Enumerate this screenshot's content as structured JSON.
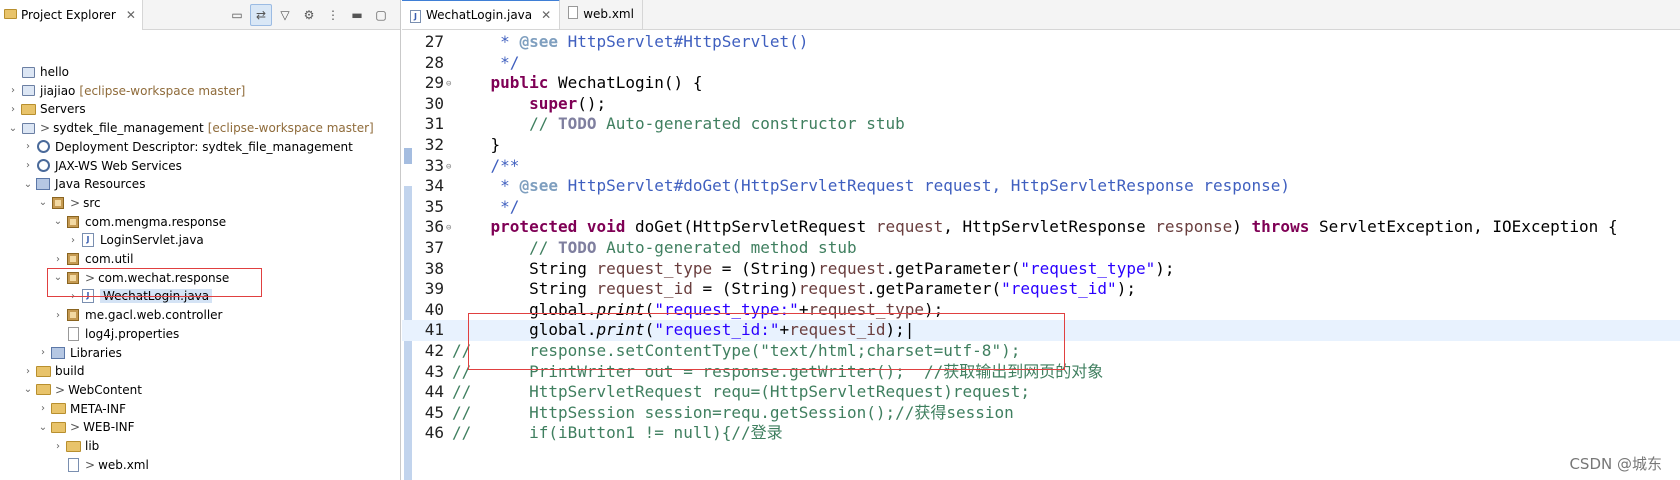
{
  "explorer": {
    "title": "Project Explorer",
    "close_glyph": "✕",
    "tools": [
      "collapse-all-icon",
      "link-editor-icon",
      "filter-icon",
      "view-options-icon",
      "view-menu-icon",
      "minimize-icon",
      "maximize-icon"
    ],
    "tree": [
      {
        "label": "hello",
        "arrow": "",
        "icon": "project",
        "indent": 0,
        "dim": ""
      },
      {
        "label": "jiajiao",
        "arrow": ">",
        "icon": "project",
        "indent": 0,
        "dim": "[eclipse-workspace master]"
      },
      {
        "label": "Servers",
        "arrow": ">",
        "icon": "folder",
        "indent": 0,
        "dim": ""
      },
      {
        "label": "sydtek_file_management",
        "arrow": "v",
        "icon": "project",
        "indent": 0,
        "dim": "[eclipse-workspace master]",
        "pre": ">"
      },
      {
        "label": "Deployment Descriptor: sydtek_file_management",
        "arrow": ">",
        "icon": "gear",
        "indent": 1,
        "dim": ""
      },
      {
        "label": "JAX-WS Web Services",
        "arrow": ">",
        "icon": "gear",
        "indent": 1,
        "dim": ""
      },
      {
        "label": "Java Resources",
        "arrow": "v",
        "icon": "lib",
        "indent": 1,
        "dim": ""
      },
      {
        "label": "src",
        "arrow": "v",
        "icon": "pkg",
        "indent": 2,
        "dim": "",
        "pre": ">"
      },
      {
        "label": "com.mengma.response",
        "arrow": "v",
        "icon": "pkg",
        "indent": 3,
        "dim": ""
      },
      {
        "label": "LoginServlet.java",
        "arrow": ">",
        "icon": "java",
        "indent": 4,
        "dim": ""
      },
      {
        "label": "com.util",
        "arrow": ">",
        "icon": "pkg",
        "indent": 3,
        "dim": ""
      },
      {
        "label": "com.wechat.response",
        "arrow": "v",
        "icon": "pkg",
        "indent": 3,
        "dim": "",
        "pre": ">"
      },
      {
        "label": "WechatLogin.java",
        "arrow": ">",
        "icon": "java",
        "indent": 4,
        "dim": "",
        "selected": true
      },
      {
        "label": "me.gacl.web.controller",
        "arrow": ">",
        "icon": "pkg",
        "indent": 3,
        "dim": ""
      },
      {
        "label": "log4j.properties",
        "arrow": "",
        "icon": "file",
        "indent": 3,
        "dim": ""
      },
      {
        "label": "Libraries",
        "arrow": ">",
        "icon": "lib",
        "indent": 2,
        "dim": ""
      },
      {
        "label": "build",
        "arrow": ">",
        "icon": "folder",
        "indent": 1,
        "dim": ""
      },
      {
        "label": "WebContent",
        "arrow": "v",
        "icon": "folder",
        "indent": 1,
        "dim": "",
        "pre": ">"
      },
      {
        "label": "META-INF",
        "arrow": ">",
        "icon": "folder",
        "indent": 2,
        "dim": ""
      },
      {
        "label": "WEB-INF",
        "arrow": "v",
        "icon": "folder",
        "indent": 2,
        "dim": "",
        "pre": ">"
      },
      {
        "label": "lib",
        "arrow": ">",
        "icon": "folder",
        "indent": 3,
        "dim": ""
      },
      {
        "label": "web.xml",
        "arrow": "",
        "icon": "xml",
        "indent": 3,
        "dim": "",
        "pre": ">"
      }
    ]
  },
  "editor": {
    "tabs": [
      {
        "label": "WechatLogin.java",
        "active": true,
        "close": "✕"
      },
      {
        "label": "web.xml",
        "active": false,
        "close": ""
      }
    ],
    "lines": [
      {
        "n": "27",
        "fold": "",
        "html": "     <span class=\"jd\">* <span class=\"tag\">@see</span> HttpServlet#HttpServlet()</span>"
      },
      {
        "n": "28",
        "fold": "",
        "html": "     <span class=\"jd\">*/</span>"
      },
      {
        "n": "29",
        "fold": "⊖",
        "html": "    <span class=\"kw\">public</span> WechatLogin() {"
      },
      {
        "n": "30",
        "fold": "",
        "html": "        <span class=\"kw\">super</span>();"
      },
      {
        "n": "31",
        "fold": "",
        "html": "        <span class=\"cm\">// <span class=\"ann\">TODO</span> Auto-generated constructor stub</span>"
      },
      {
        "n": "32",
        "fold": "",
        "html": "    }"
      },
      {
        "n": "33",
        "fold": "⊖",
        "html": "    <span class=\"jd\">/**</span>"
      },
      {
        "n": "34",
        "fold": "",
        "html": "     <span class=\"jd\">* <span class=\"tag\">@see</span> HttpServlet#doGet(HttpServletRequest request, HttpServletResponse response)</span>"
      },
      {
        "n": "35",
        "fold": "",
        "html": "     <span class=\"jd\">*/</span>"
      },
      {
        "n": "36",
        "fold": "⊖",
        "html": "    <span class=\"kw\">protected void</span> doGet(HttpServletRequest <span class=\"var\">request</span>, HttpServletResponse <span class=\"var\">response</span>) <span class=\"kw\">throws</span> ServletException, IOException {"
      },
      {
        "n": "37",
        "fold": "",
        "html": "        <span class=\"cm\">// <span class=\"ann\">TODO</span> Auto-generated method stub</span>"
      },
      {
        "n": "38",
        "fold": "",
        "html": "        String <span class=\"var\">request_type</span> = (String)<span class=\"var\">request</span>.getParameter(<span class=\"str\">\"request_type\"</span>);"
      },
      {
        "n": "39",
        "fold": "",
        "html": "        String <span class=\"var\">request_id</span> = (String)<span class=\"var\">request</span>.getParameter(<span class=\"str\">\"request_id\"</span>);"
      },
      {
        "n": "40",
        "fold": "",
        "html": "        global.<span class=\"it\">print</span>(<span class=\"str\">\"request_type:\"</span>+<span class=\"var\">request_type</span>);"
      },
      {
        "n": "41",
        "fold": "",
        "html": "        global.<span class=\"it\">print</span>(<span class=\"str\">\"request_id:\"</span>+<span class=\"var\">request_id</span>);|",
        "current": true
      },
      {
        "n": "42",
        "fold": "",
        "html": "<span class=\"cm\">//      response.setContentType(\"text/html;charset=utf-8\");</span>"
      },
      {
        "n": "43",
        "fold": "",
        "html": "<span class=\"cm\">//      PrintWriter out = response.getWriter();  //获取输出到网页的对象</span>"
      },
      {
        "n": "44",
        "fold": "",
        "html": "<span class=\"cm\">//      HttpServletRequest requ=(HttpServletRequest)request;</span>"
      },
      {
        "n": "45",
        "fold": "",
        "html": "<span class=\"cm\">//      HttpSession session=requ.getSession();//获得session</span>"
      },
      {
        "n": "46",
        "fold": "",
        "html": "<span class=\"cm\">//      if(iButton1 != null){//登录</span>"
      }
    ]
  },
  "watermark": "CSDN @城东",
  "colors": {
    "highlight_box": "#e04040",
    "keyword": "#7f0055",
    "comment": "#3f7f5f",
    "string": "#2a00ff",
    "javadoc": "#3f5fbf"
  }
}
